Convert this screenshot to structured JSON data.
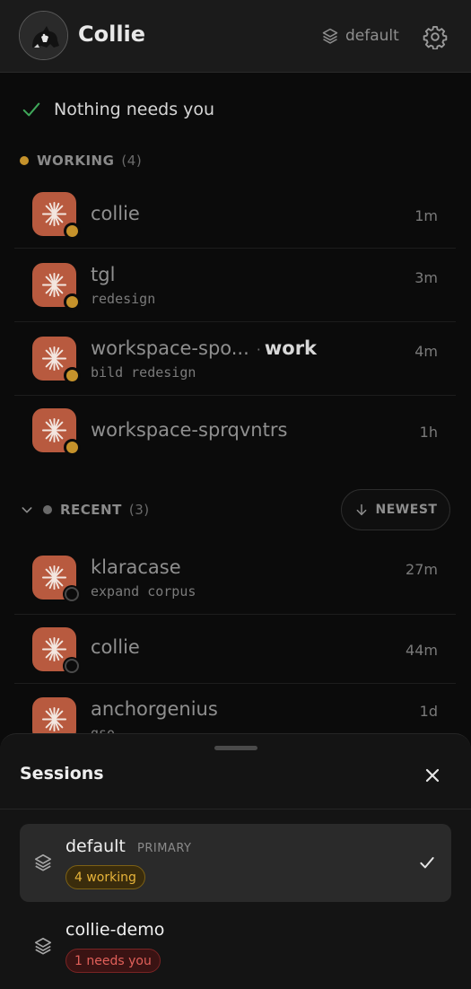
{
  "header": {
    "title": "Collie",
    "environment_label": "default",
    "colors": {
      "bg": "#1b1b1b"
    }
  },
  "status": {
    "text": "Nothing needs you",
    "color": "#3fa85a"
  },
  "working": {
    "label": "WORKING",
    "count": "(4)",
    "color": "#c5922b",
    "items": [
      {
        "title": "collie",
        "subtitle": "",
        "tag": "",
        "time": "1m"
      },
      {
        "title": "tgl",
        "subtitle": "redesign",
        "tag": "",
        "time": "3m"
      },
      {
        "title": "workspace-spo...",
        "subtitle": "bild redesign",
        "tag": "work",
        "time": "4m"
      },
      {
        "title": "workspace-sprqvntrs",
        "subtitle": "",
        "tag": "",
        "time": "1h"
      }
    ]
  },
  "recent": {
    "label": "RECENT",
    "count": "(3)",
    "sort_label": "NEWEST",
    "items": [
      {
        "title": "klaracase",
        "subtitle": "expand corpus",
        "time": "27m"
      },
      {
        "title": "collie",
        "subtitle": "",
        "time": "44m"
      },
      {
        "title": "anchorgenius",
        "subtitle": "gso",
        "time": "1d"
      }
    ]
  },
  "sheet": {
    "title": "Sessions",
    "sessions": [
      {
        "name": "default",
        "role": "PRIMARY",
        "status": "4 working",
        "status_kind": "warn",
        "selected": true
      },
      {
        "name": "collie-demo",
        "role": "",
        "status": "1 needs you",
        "status_kind": "alert",
        "selected": false
      }
    ]
  },
  "icons": {
    "avatar": "dog-avatar-icon",
    "environment": "layers-icon",
    "settings": "gear-icon",
    "status": "check-icon",
    "app": "sparkle-icon",
    "sort": "arrow-down-icon",
    "collapse": "chevron-down-icon",
    "close": "close-icon",
    "selected": "check-icon"
  },
  "colors": {
    "accent_app": "#b85a3f",
    "working": "#c5922b",
    "alert": "#e2605a",
    "ok": "#3fa85a"
  }
}
